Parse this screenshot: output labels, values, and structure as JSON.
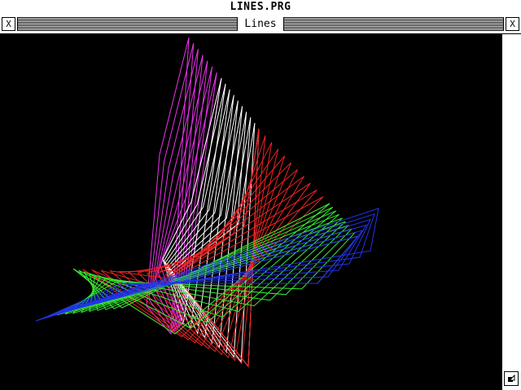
{
  "menubar": {
    "title": "LINES.PRG"
  },
  "window": {
    "title": "Lines",
    "close_icon": "X",
    "fuller_icon": "X"
  },
  "colors": {
    "magenta": "#ee33ee",
    "white": "#ffffff",
    "red": "#ee2222",
    "green": "#33ee33",
    "blue": "#2233ee",
    "background": "#000000"
  }
}
